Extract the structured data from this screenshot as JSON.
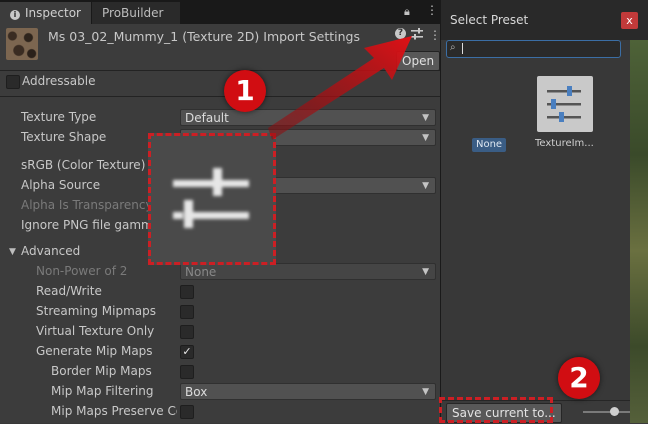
{
  "tabs": [
    {
      "icon": "info-icon",
      "label": "Inspector"
    },
    {
      "label": "ProBuilder"
    }
  ],
  "header": {
    "title": "Ms 03_02_Mummy_1 (Texture 2D) Import Settings",
    "open_button": "Open"
  },
  "addressable": {
    "label": "Addressable",
    "checked": false
  },
  "rows": {
    "texture_type": {
      "label": "Texture Type",
      "value": "Default"
    },
    "texture_shape": {
      "label": "Texture Shape"
    },
    "srgb": {
      "label": "sRGB (Color Texture)"
    },
    "alpha_source": {
      "label": "Alpha Source"
    },
    "alpha_is_transparency": {
      "label": "Alpha Is Transparency"
    },
    "ignore_png": {
      "label": "Ignore PNG file gamma"
    },
    "advanced": {
      "label": "Advanced"
    },
    "non_power_of_2": {
      "label": "Non-Power of 2",
      "value": "None"
    },
    "read_write": {
      "label": "Read/Write",
      "checked": false
    },
    "streaming_mipmaps": {
      "label": "Streaming Mipmaps",
      "checked": false
    },
    "virtual_texture_only": {
      "label": "Virtual Texture Only",
      "checked": false
    },
    "generate_mip_maps": {
      "label": "Generate Mip Maps",
      "checked": true,
      "check_glyph": "✓"
    },
    "border_mip_maps": {
      "label": "Border Mip Maps",
      "checked": false
    },
    "mip_map_filtering": {
      "label": "Mip Map Filtering",
      "value": "Box"
    },
    "mip_maps_preserve": {
      "label": "Mip Maps Preserve Co",
      "checked": false
    }
  },
  "preset_window": {
    "title": "Select Preset",
    "close_glyph": "x",
    "none_label": "None",
    "preset_item_label": "TextureIm...",
    "save_button": "Save current to..."
  },
  "callouts": {
    "one": "1",
    "two": "2"
  },
  "colors": {
    "callout_red": "#d10d12",
    "selection_blue": "#3a5d85"
  }
}
